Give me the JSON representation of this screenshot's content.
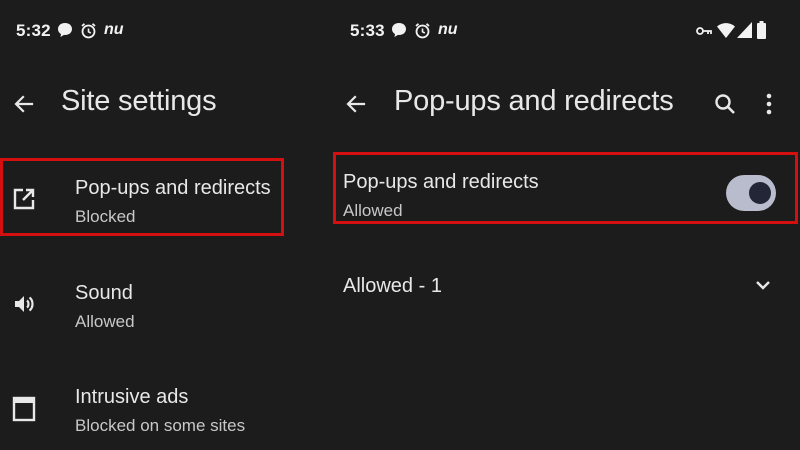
{
  "left_screen": {
    "status_bar": {
      "time": "5:32",
      "icons": [
        "chat-bubble-icon",
        "alarm-icon",
        "nu-app-icon"
      ],
      "nu_text": "nu"
    },
    "toolbar": {
      "back_icon": "arrow-back-icon",
      "title": "Site settings"
    },
    "items": [
      {
        "icon": "open-in-new-icon",
        "title": "Pop-ups and redirects",
        "subtitle": "Blocked",
        "highlighted": true
      },
      {
        "icon": "volume-icon",
        "title": "Sound",
        "subtitle": "Allowed"
      },
      {
        "icon": "window-icon",
        "title": "Intrusive ads",
        "subtitle": "Blocked on some sites"
      }
    ]
  },
  "right_screen": {
    "status_bar": {
      "time": "5:33",
      "icons": [
        "chat-bubble-icon",
        "alarm-icon",
        "nu-app-icon"
      ],
      "nu_text": "nu",
      "system_icons": [
        "vpn-key-icon",
        "wifi-icon",
        "signal-icon",
        "battery-icon"
      ]
    },
    "toolbar": {
      "back_icon": "arrow-back-icon",
      "title": "Pop-ups and redirects",
      "actions": [
        "search-icon",
        "more-vert-icon"
      ]
    },
    "setting": {
      "title": "Pop-ups and redirects",
      "subtitle": "Allowed",
      "toggle_on": true,
      "highlighted": true
    },
    "allowed_section": {
      "label": "Allowed - 1",
      "expand_icon": "chevron-down-icon"
    }
  },
  "colors": {
    "background": "#1c1c1c",
    "text_primary": "#e8e8e8",
    "text_secondary": "#c8c8c8",
    "highlight_border": "#d40f0f",
    "toggle_track": "#b9bccd",
    "toggle_thumb": "#232637"
  }
}
